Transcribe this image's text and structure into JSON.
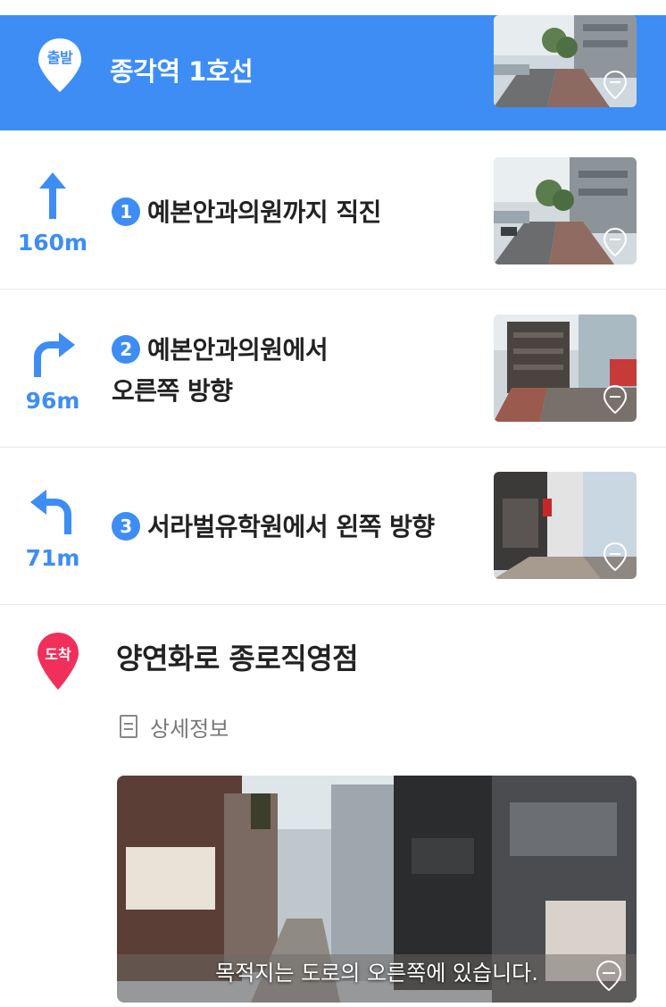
{
  "start": {
    "badge": "출발",
    "title": "종각역 1호선"
  },
  "steps": [
    {
      "num": "1",
      "distance": "160m",
      "text": "예본안과의원까지 직진",
      "direction": "straight-arrow-icon"
    },
    {
      "num": "2",
      "distance": "96m",
      "text_line1": "예본안과의원에서",
      "text_line2": "오른쪽 방향",
      "direction": "turn-right-arrow-icon"
    },
    {
      "num": "3",
      "distance": "71m",
      "text": "서라벌유학원에서 왼쪽 방향",
      "direction": "turn-left-arrow-icon"
    }
  ],
  "end": {
    "badge": "도착",
    "title": "양연화로 종로직영점",
    "detail_label": "상세정보",
    "photo_caption": "목적지는 도로의 오른쪽에 있습니다."
  },
  "colors": {
    "accent": "#3d8df5",
    "end_pin": "#f0305a"
  }
}
